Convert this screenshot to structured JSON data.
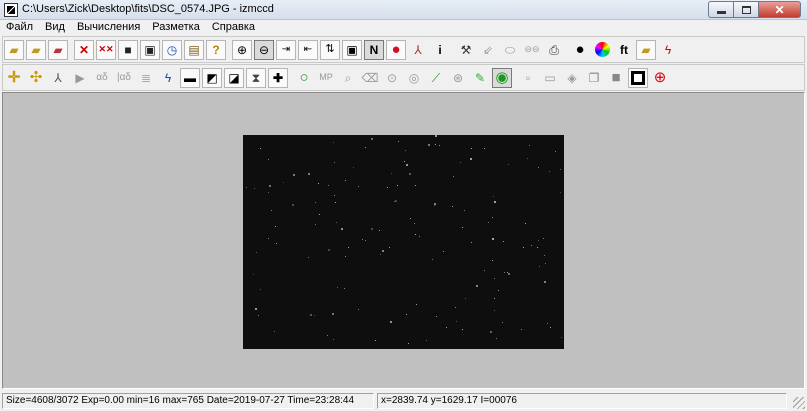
{
  "window": {
    "title": "C:\\Users\\Zick\\Desktop\\fits\\DSC_0574.JPG - izmccd"
  },
  "menu": [
    "Файл",
    "Вид",
    "Вычисления",
    "Разметка",
    "Справка"
  ],
  "toolbar1": {
    "icons": [
      "open-folder-icon",
      "open-folder-arrow-icon",
      "open-folder-red-icon",
      "delete-x-icon",
      "delete-multiple-x-icon",
      "save-disk-icon",
      "save-multiple-icon",
      "clock-icon",
      "checklist-icon",
      "help-question-icon",
      "zoom-in-icon",
      "zoom-out-icon",
      "fit-right-icon",
      "fit-width-icon",
      "flip-vertical-icon",
      "frame-icon",
      "north-icon",
      "red-globe-icon",
      "graph-icon",
      "info-icon",
      "hammer-icon",
      "arrow-diagonal-icon",
      "ellipse-icon",
      "double-ellipse-icon",
      "printer-icon",
      "black-dots-icon",
      "color-wheel-icon",
      "fourier-icon",
      "folder-open-icon",
      "lightning-icon"
    ],
    "text_labels": {
      "north": "N",
      "info": "i",
      "fourier": "ft"
    }
  },
  "toolbar2": {
    "icons": [
      "crosshair-plus-icon",
      "crosshair-yellow-icon",
      "angle-icon",
      "play-triangle-icon",
      "alpha-beta-icon",
      "alpha-beta-box-icon",
      "list-icon",
      "lightning-blue-icon",
      "minus-box-icon",
      "slash-box-icon",
      "triangle-box-icon",
      "hourglass-box-icon",
      "plus-box-icon",
      "green-circle-icon",
      "mp-icon",
      "magnifier-icon",
      "eraser-icon",
      "circle-arrow-icon",
      "circle-target-icon",
      "ruler-icon",
      "measure-icon",
      "pencil-green-icon",
      "ring-icon",
      "small-box-icon",
      "small-box-arrow-icon",
      "layers-icon",
      "stack-icon",
      "gray-square-icon",
      "black-square-icon",
      "red-crosshair-icon"
    ],
    "text_labels": {
      "mp": "MP",
      "alpha_beta": "αδ"
    }
  },
  "statusbar": {
    "info": "Size=4608/3072 Exp=0.00 min=16 max=765 Date=2019-07-27 Time=23:28:44",
    "coords": "x=2839.74 y=1629.17 I=00076"
  },
  "colors": {
    "workspace": "#c0c0c0",
    "image_background": "#0e0e0e",
    "star": "#dddddd"
  }
}
